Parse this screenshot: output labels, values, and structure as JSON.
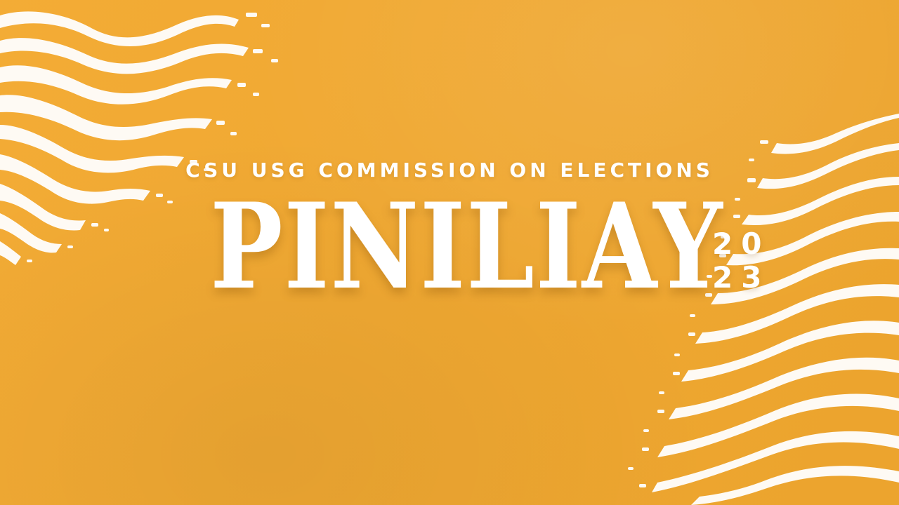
{
  "canvas": {
    "background_color": "#f3a92f"
  },
  "header": {
    "subtitle": "CSU USG COMMISSION ON ELECTIONS",
    "title": "PINILIAY",
    "year_top": "20",
    "year_bottom": "23"
  },
  "decorations": {
    "top_left_pattern": "wave-dot-pattern",
    "bottom_right_pattern": "wave-dot-pattern"
  }
}
